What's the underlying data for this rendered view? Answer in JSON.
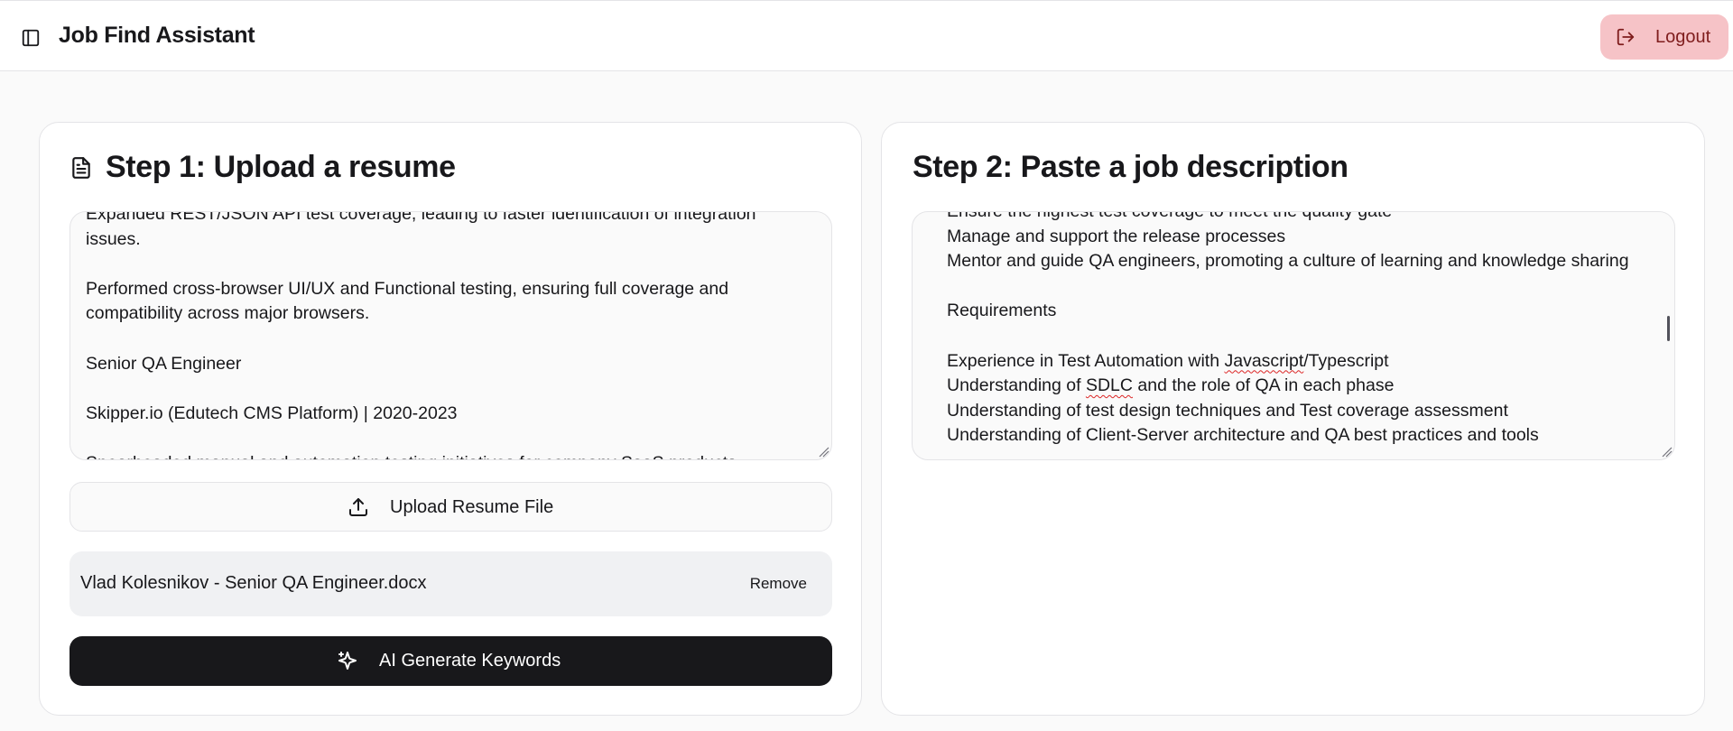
{
  "header": {
    "title": "Job Find Assistant",
    "logout_label": "Logout",
    "toggle_icon": "sidebar-toggle-icon",
    "logout_icon": "logout-icon",
    "logout_bg": "#f6c3c7"
  },
  "step1": {
    "title": "Step 1: Upload a resume",
    "icon": "document-icon",
    "resume_text": "Expanded REST/JSON API test coverage, leading to faster identification of integration issues.\n\nPerformed cross-browser UI/UX and Functional testing, ensuring full coverage and compatibility across major browsers.\n\nSenior QA Engineer\n\nSkipper.io (Edutech CMS Platform) | 2020-2023\n\nSpearheaded manual and automation testing initiatives for company SaaS products",
    "upload_label": "Upload Resume File",
    "upload_icon": "upload-icon",
    "file_name": "Vlad Kolesnikov - Senior QA Engineer.docx",
    "remove_label": "Remove",
    "generate_label": "AI Generate Keywords",
    "generate_icon": "sparkles-icon"
  },
  "step2": {
    "title": "Step 2: Paste a job description",
    "jd_lines": [
      "Ensure the highest test coverage to meet the quality gate",
      "Manage and support the release processes",
      "Mentor and guide QA engineers, promoting a culture of learning and knowledge sharing",
      "",
      "Requirements",
      "",
      "Experience in Test Automation with Javascript/Typescript",
      "Understanding of SDLC and the role of QA in each phase",
      "Understanding of test design techniques and Test coverage assessment",
      "Understanding of Client-Server architecture and QA best practices and tools"
    ]
  }
}
